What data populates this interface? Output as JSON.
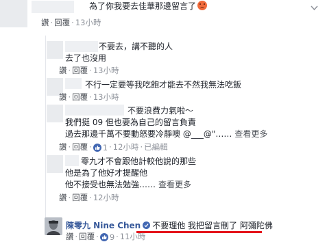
{
  "comments": [
    {
      "text": "為了你我要去佳華那邊留言了",
      "emoji": "angry-face-emoji",
      "actions": {
        "like": "讚",
        "reply": "回覆",
        "time": "13小時"
      }
    },
    {
      "lines": [
        "不要去，講不聽的人",
        "去了也沒用"
      ],
      "actions": {
        "like": "讚",
        "reply": "回覆",
        "time": "13小時"
      }
    },
    {
      "text": "不行一定要等我吃飽才能去不然我無法吃飯",
      "actions": {
        "like": "讚",
        "reply": "回覆",
        "time": "13小時"
      }
    },
    {
      "lines": [
        "不要浪費力氣啦～",
        "我們挺 09 但也要為自己的留言負責",
        "過去那邊千萬不要動怒要冷靜噢 @___@\"……"
      ],
      "see_more": "查看更多",
      "actions": {
        "like": "讚",
        "reply": "回覆",
        "likes": "1",
        "time": "12小時",
        "edited": "已編輯"
      }
    },
    {
      "lines": [
        "零九才不會跟他計較他說的那些",
        "他是為了他好才提醒他",
        "他不接受也無法勉強……"
      ],
      "see_more": "查看更多",
      "actions": {
        "like": "讚",
        "reply": "回覆",
        "time": "12小時"
      }
    },
    {
      "author": "陳零九 Nine Chen",
      "text": "不要理他 我把留言刪了 阿彌陀佛",
      "actions": {
        "like": "讚",
        "reply": "回覆",
        "likes": "9",
        "time": "11小時"
      }
    }
  ],
  "colors": {
    "link": "#365899",
    "meta": "#90949c",
    "like": "#4267b2",
    "underline": "#e4141b"
  }
}
